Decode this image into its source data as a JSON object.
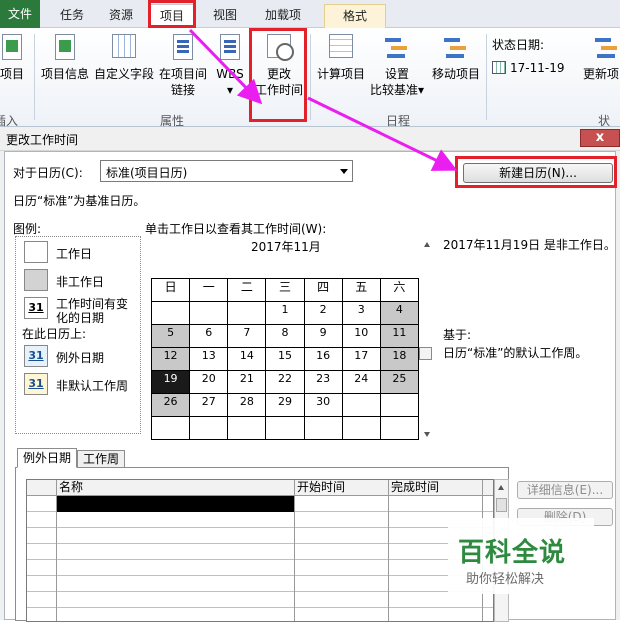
{
  "ribbon": {
    "tabs": [
      "文件",
      "任务",
      "资源",
      "项目",
      "视图",
      "加载项",
      "格式"
    ],
    "buttons": {
      "project_partial": "项目",
      "project_info": "项目信息",
      "custom_fields": "自定义字段",
      "links_line1": "在项目间",
      "links_line2": "链接",
      "wbs": "WBS",
      "change_worktime_line1": "更改",
      "change_worktime_line2": "工作时间",
      "calc_project": "计算项目",
      "baseline_line1": "设置",
      "baseline_line2": "比较基准",
      "move_project": "移动项目",
      "update_project": "更新项目"
    },
    "groups": {
      "insert_partial": "插入",
      "properties": "属性",
      "schedule": "日程",
      "status_partial": "状态"
    },
    "status_date": {
      "label": "状态日期:",
      "value": "17-11-19"
    },
    "dropdown_mark": "▾"
  },
  "dialog": {
    "title": "更改工作时间",
    "close": "x",
    "for_calendar_label": "对于日历(C):",
    "calendar_value": "标准(项目日历)",
    "new_calendar_button": "新建日历(N)...",
    "base_calendar_text": "日历“标准”为基准日历。",
    "legend": {
      "title": "图例:",
      "working": "工作日",
      "nonworking": "非工作日",
      "nondefault_line1": "工作时间有变",
      "nondefault_line2": "化的日期",
      "on_this_calendar": "在此日历上:",
      "exception": "例外日期",
      "nondefault_week": "非默认工作周",
      "swatch_num": "31"
    },
    "calendar_instruction": "单击工作日以查看其工作时间(W):",
    "month_title": "2017年11月",
    "weekdays": [
      "日",
      "一",
      "二",
      "三",
      "四",
      "五",
      "六"
    ],
    "weeks": [
      [
        "",
        "",
        "",
        "1",
        "2",
        "3",
        "4"
      ],
      [
        "5",
        "6",
        "7",
        "8",
        "9",
        "10",
        "11"
      ],
      [
        "12",
        "13",
        "14",
        "15",
        "16",
        "17",
        "18"
      ],
      [
        "19",
        "20",
        "21",
        "22",
        "23",
        "24",
        "25"
      ],
      [
        "26",
        "27",
        "28",
        "29",
        "30",
        "",
        ""
      ],
      [
        "",
        "",
        "",
        "",
        "",
        "",
        ""
      ]
    ],
    "selected_day": "19",
    "selected_info": "2017年11月19日 是非工作日。",
    "based_on_label": "基于:",
    "based_on_text": "日历“标准”的默认工作周。",
    "tabs": [
      "例外日期",
      "工作周"
    ],
    "grid_headers": {
      "name": "名称",
      "start": "开始时间",
      "finish": "完成时间"
    },
    "details_button": "详细信息(E)...",
    "delete_button": "删除(D)"
  },
  "watermark": {
    "title": "百科全说",
    "subtitle": "助你轻松解决"
  },
  "colors": {
    "highlight": "#e3212b",
    "arrow": "#ea1ef0",
    "file_tab": "#2b7a3b"
  }
}
